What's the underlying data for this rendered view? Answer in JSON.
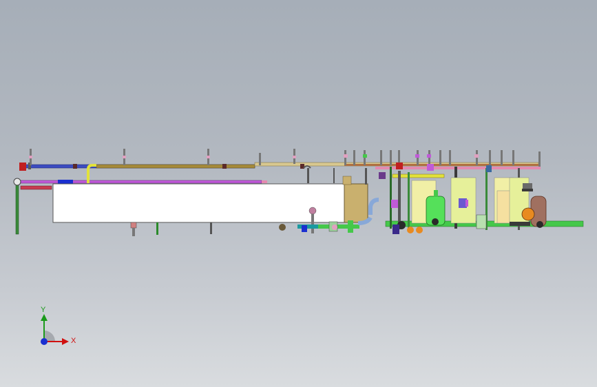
{
  "view": {
    "background_top": "#a6aeb8",
    "background_bottom": "#d9dcdf"
  },
  "triad": {
    "x_label": "X",
    "y_label": "Y",
    "x_color": "#d01010",
    "y_color": "#1a9a1a",
    "z_color": "#1a2fd0"
  },
  "model": {
    "tank_color": "#ffffff",
    "tank_end_color": "#c9b06e",
    "green_pipe_color": "#45c84a",
    "magenta_pipe_color": "#c05ad8",
    "pink_pipe_color": "#e58ab0",
    "yellow_pipe_color": "#e2e23a"
  }
}
